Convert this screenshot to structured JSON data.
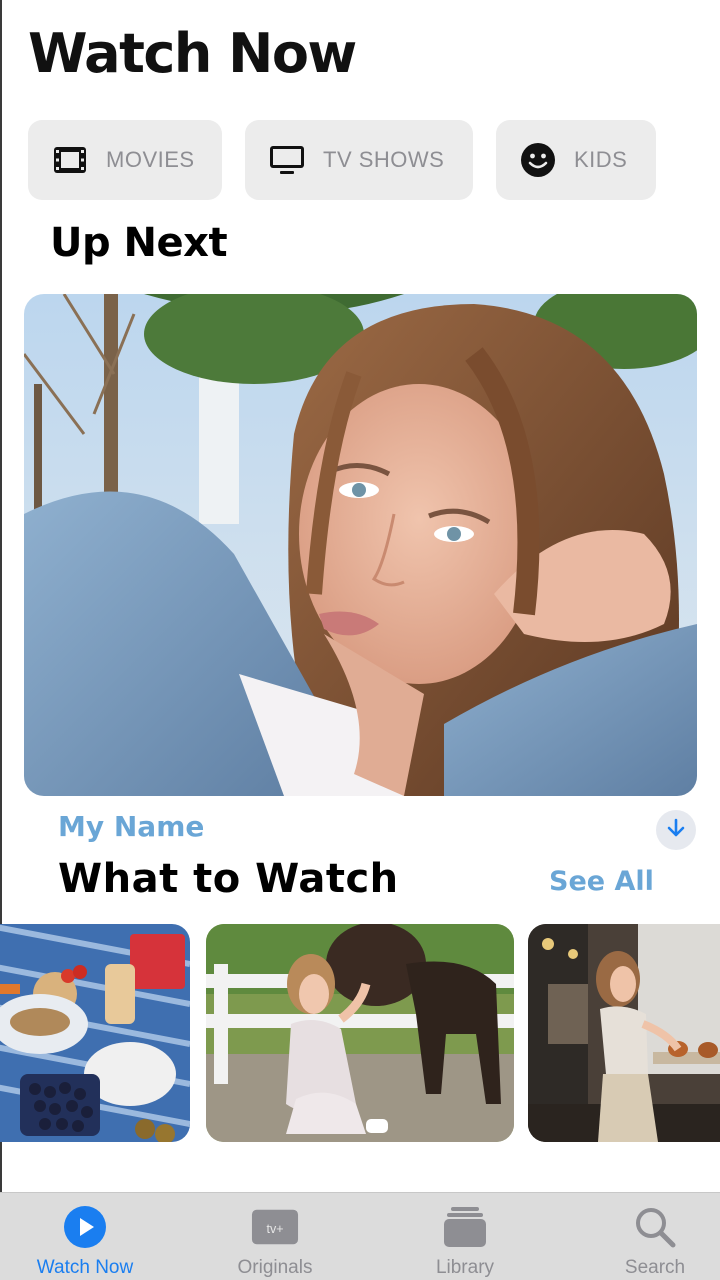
{
  "header": {
    "title": "Watch Now"
  },
  "categories": [
    {
      "label": "MOVIES",
      "icon": "film-icon"
    },
    {
      "label": "TV SHOWS",
      "icon": "tv-icon"
    },
    {
      "label": "KIDS",
      "icon": "smiley-icon"
    }
  ],
  "up_next": {
    "heading": "Up Next",
    "item_title": "My Name",
    "download_icon": "download-arrow-icon"
  },
  "what_to_watch": {
    "heading": "What to Watch",
    "see_all_label": "See All"
  },
  "tab_bar": {
    "active_color": "#1a7ef0",
    "inactive_color": "#8e8e93",
    "tabs": [
      {
        "label": "Watch Now",
        "icon": "play-circle-icon"
      },
      {
        "label": "Originals",
        "icon": "appletv-plus-icon",
        "badge": "tv+"
      },
      {
        "label": "Library",
        "icon": "library-stack-icon"
      },
      {
        "label": "Search",
        "icon": "search-icon"
      }
    ]
  },
  "colors": {
    "accent": "#6aa6d6",
    "chip_bg": "#ececec"
  }
}
